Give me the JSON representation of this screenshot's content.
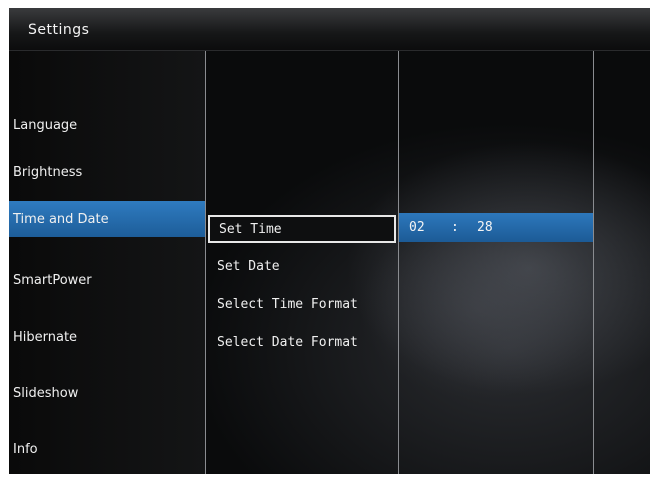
{
  "header": {
    "title": "Settings"
  },
  "sidebar": {
    "items": [
      {
        "label": "Language"
      },
      {
        "label": "Brightness"
      },
      {
        "label": "Time and Date",
        "selected": true
      },
      {
        "label": "SmartPower"
      },
      {
        "label": "Hibernate"
      },
      {
        "label": "Slideshow"
      },
      {
        "label": "Info"
      }
    ],
    "scroll_icon": "chevron-down-icon"
  },
  "options": {
    "items": [
      {
        "label": "Set Time",
        "focused": true
      },
      {
        "label": "Set Date"
      },
      {
        "label": "Select Time Format"
      },
      {
        "label": "Select Date Format"
      }
    ]
  },
  "time_value": {
    "hour": "02",
    "separator": ":",
    "minute": "28"
  },
  "colors": {
    "accent": "#2a72b5",
    "background": "#0c0d0e",
    "text": "#f0f0f0",
    "focus_border": "#e8e8e8"
  }
}
